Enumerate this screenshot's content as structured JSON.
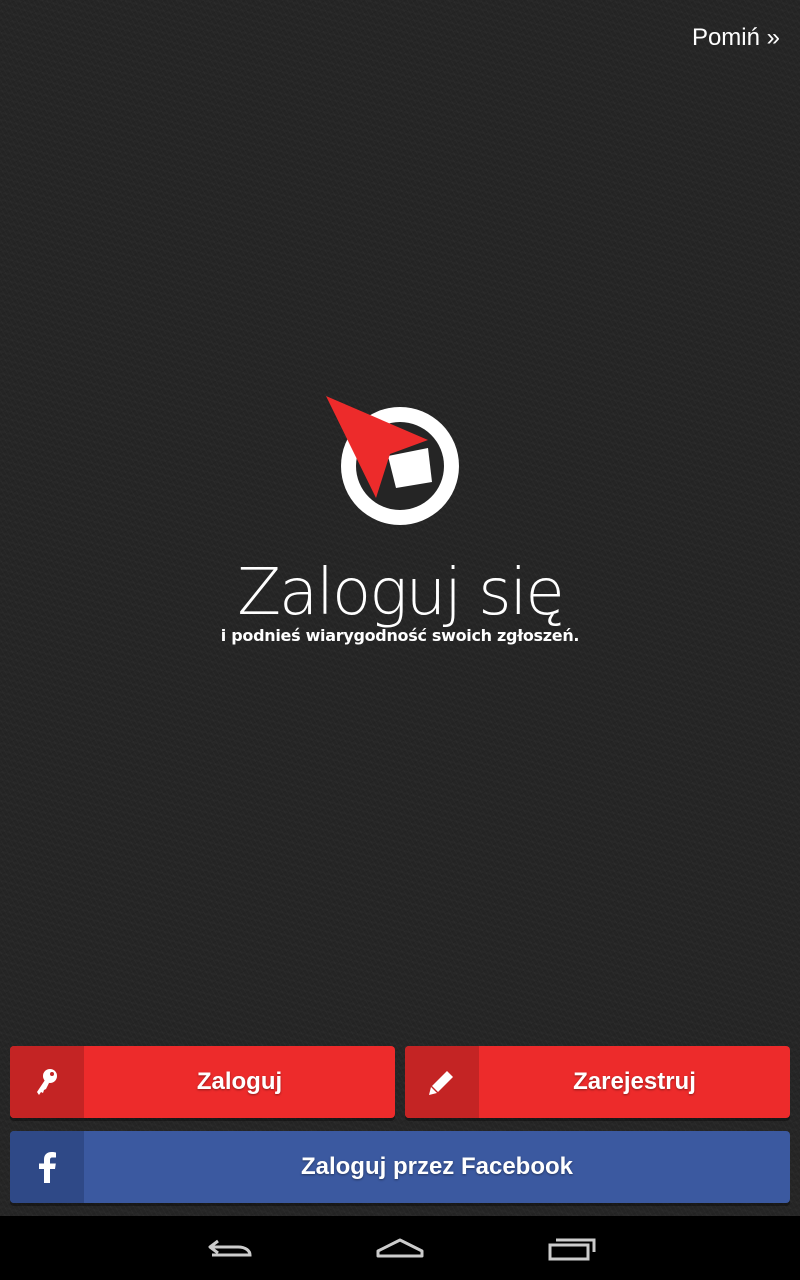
{
  "header": {
    "skip_label": "Pomiń »"
  },
  "main": {
    "title": "Zaloguj się",
    "subtitle": "i podnieś wiarygodność swoich zgłoszeń."
  },
  "buttons": {
    "login_label": "Zaloguj",
    "login_icon": "key-icon",
    "register_label": "Zarejestruj",
    "register_icon": "pencil-icon",
    "facebook_label": "Zaloguj przez Facebook",
    "facebook_icon": "facebook-icon"
  },
  "navbar": {
    "back_icon": "back-icon",
    "home_icon": "home-icon",
    "recents_icon": "recent-apps-icon"
  },
  "colors": {
    "background": "#252525",
    "accent_red": "#ed2b2b",
    "accent_red_dark": "#c42424",
    "facebook_blue": "#3b59a0",
    "facebook_blue_dark": "#2f4987"
  }
}
